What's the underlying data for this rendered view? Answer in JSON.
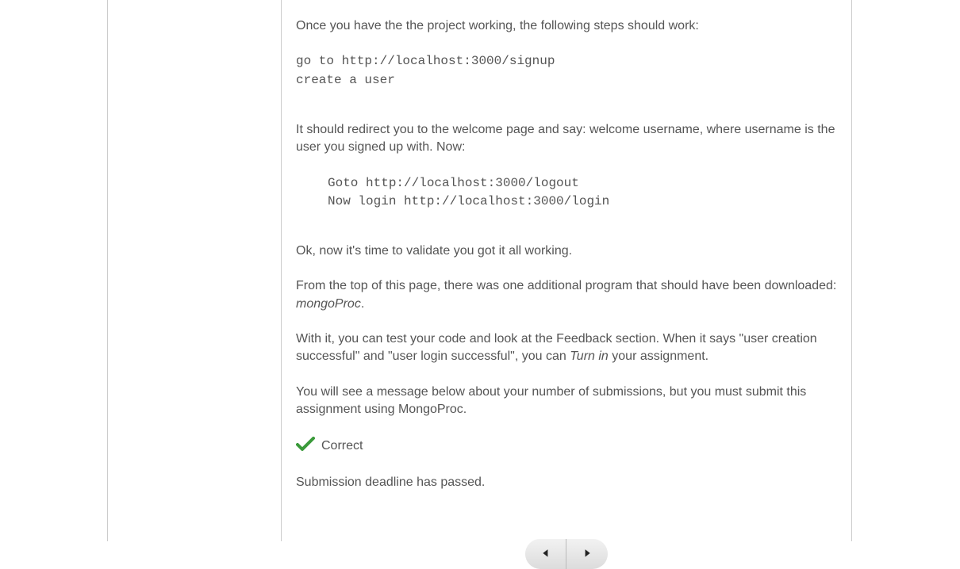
{
  "content": {
    "intro": "Once you have the the project working, the following steps should work:",
    "code1": "go to http://localhost:3000/signup\ncreate a user",
    "redirect_text": "It should redirect you to the welcome page and say: welcome username, where username is the user you signed up with. Now:",
    "code2": "Goto http://localhost:3000/logout\nNow login http://localhost:3000/login",
    "validate": "Ok, now it's time to validate you got it all working.",
    "p4_pre": "From the top of this page, there was one additional program that should have been downloaded: ",
    "p4_em": "mongoProc",
    "p4_post": ".",
    "p5_pre": "With it, you can test your code and look at the Feedback section. When it says \"user creation successful\" and \"user login successful\", you can ",
    "p5_em": "Turn in",
    "p5_post": " your assignment.",
    "p6": "You will see a message below about your number of submissions, but you must submit this assignment using MongoProc.",
    "correct_label": "Correct",
    "deadline": "Submission deadline has passed."
  }
}
